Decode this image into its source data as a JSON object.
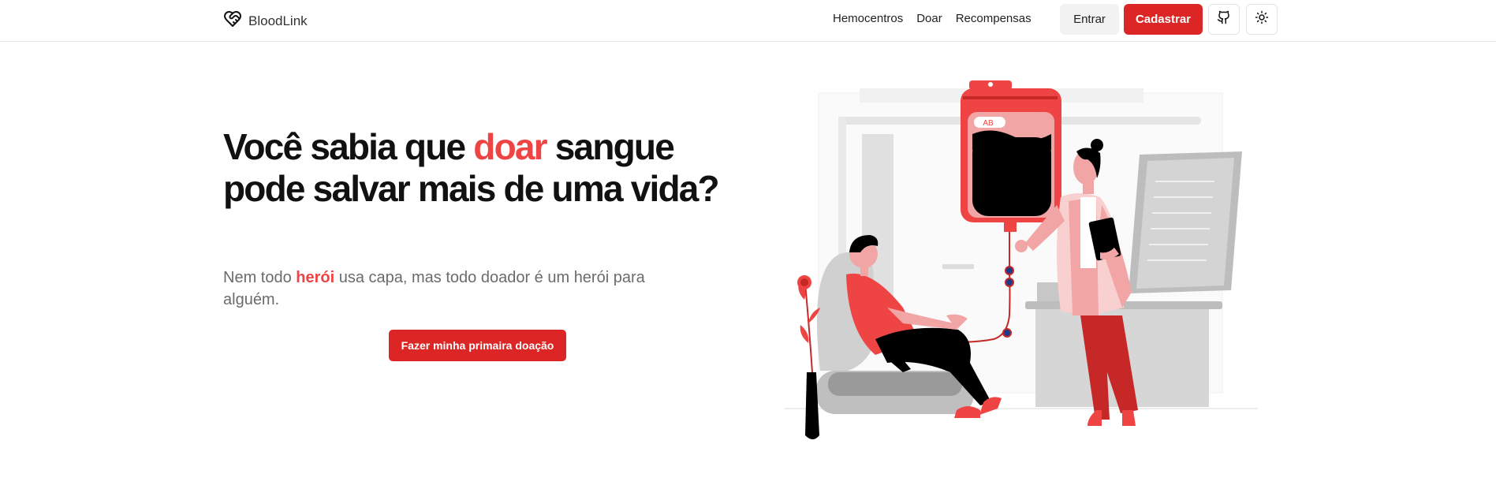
{
  "header": {
    "brand": "BloodLink",
    "nav": [
      "Hemocentros",
      "Doar",
      "Recompensas"
    ],
    "login_label": "Entrar",
    "signup_label": "Cadastrar"
  },
  "hero": {
    "title_pre": "Você sabia que ",
    "title_accent": "doar",
    "title_post": " sangue pode salvar mais de uma vida?",
    "subtitle_pre": "Nem todo ",
    "subtitle_accent": "herói",
    "subtitle_post": " usa capa, mas todo doador é um herói para alguém.",
    "cta_label": "Fazer minha primaira doação"
  },
  "illustration": {
    "blood_type_label": "AB"
  },
  "icons": {
    "brand": "heart-handshake-icon",
    "github": "github-icon",
    "theme": "sun-icon"
  },
  "colors": {
    "accent": "#dc2626",
    "accent_text": "#ef4444"
  }
}
